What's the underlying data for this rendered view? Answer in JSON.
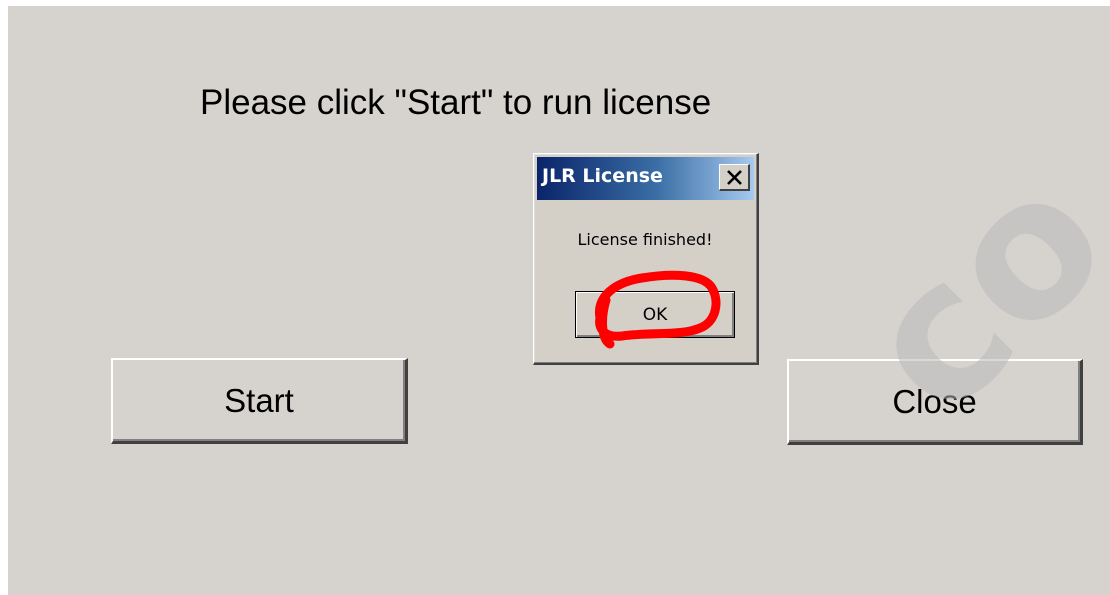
{
  "main": {
    "instruction": "Please click \"Start\" to run license",
    "start_label": "Start",
    "close_label": "Close"
  },
  "dialog": {
    "title": "JLR License",
    "close_icon": "close-x-icon",
    "message": "License finished!",
    "ok_label": "OK"
  },
  "annotation": {
    "highlight_color": "#ff0000"
  },
  "watermark": {
    "text": "co"
  },
  "colors": {
    "window_bg": "#d6d3ce",
    "title_gradient_start": "#0a246a",
    "title_gradient_end": "#a6caf0"
  }
}
